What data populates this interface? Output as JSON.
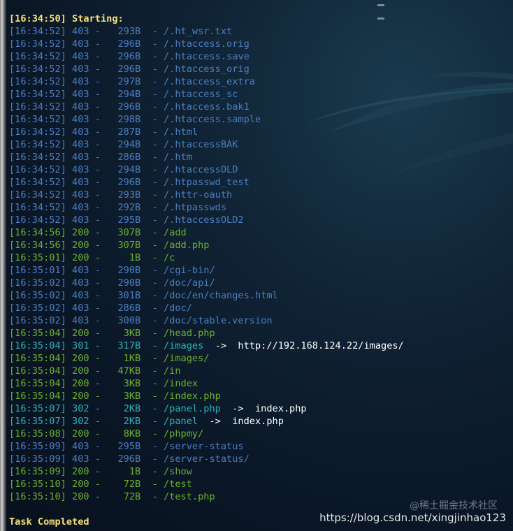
{
  "header": {
    "start_line": "[16:34:50] Starting:"
  },
  "log": [
    {
      "time": "[16:34:52]",
      "status": "403",
      "size": "293B",
      "path": "/.ht_wsr.txt",
      "redirect": ""
    },
    {
      "time": "[16:34:52]",
      "status": "403",
      "size": "296B",
      "path": "/.htaccess.orig",
      "redirect": ""
    },
    {
      "time": "[16:34:52]",
      "status": "403",
      "size": "296B",
      "path": "/.htaccess.save",
      "redirect": ""
    },
    {
      "time": "[16:34:52]",
      "status": "403",
      "size": "296B",
      "path": "/.htaccess_orig",
      "redirect": ""
    },
    {
      "time": "[16:34:52]",
      "status": "403",
      "size": "297B",
      "path": "/.htaccess_extra",
      "redirect": ""
    },
    {
      "time": "[16:34:52]",
      "status": "403",
      "size": "294B",
      "path": "/.htaccess_sc",
      "redirect": ""
    },
    {
      "time": "[16:34:52]",
      "status": "403",
      "size": "296B",
      "path": "/.htaccess.bak1",
      "redirect": ""
    },
    {
      "time": "[16:34:52]",
      "status": "403",
      "size": "298B",
      "path": "/.htaccess.sample",
      "redirect": ""
    },
    {
      "time": "[16:34:52]",
      "status": "403",
      "size": "287B",
      "path": "/.html",
      "redirect": ""
    },
    {
      "time": "[16:34:52]",
      "status": "403",
      "size": "294B",
      "path": "/.htaccessBAK",
      "redirect": ""
    },
    {
      "time": "[16:34:52]",
      "status": "403",
      "size": "286B",
      "path": "/.htm",
      "redirect": ""
    },
    {
      "time": "[16:34:52]",
      "status": "403",
      "size": "294B",
      "path": "/.htaccessOLD",
      "redirect": ""
    },
    {
      "time": "[16:34:52]",
      "status": "403",
      "size": "296B",
      "path": "/.htpasswd_test",
      "redirect": ""
    },
    {
      "time": "[16:34:52]",
      "status": "403",
      "size": "293B",
      "path": "/.httr-oauth",
      "redirect": ""
    },
    {
      "time": "[16:34:52]",
      "status": "403",
      "size": "292B",
      "path": "/.htpasswds",
      "redirect": ""
    },
    {
      "time": "[16:34:52]",
      "status": "403",
      "size": "295B",
      "path": "/.htaccessOLD2",
      "redirect": ""
    },
    {
      "time": "[16:34:56]",
      "status": "200",
      "size": "307B",
      "path": "/add",
      "redirect": ""
    },
    {
      "time": "[16:34:56]",
      "status": "200",
      "size": "307B",
      "path": "/add.php",
      "redirect": ""
    },
    {
      "time": "[16:35:01]",
      "status": "200",
      "size": "1B",
      "path": "/c",
      "redirect": ""
    },
    {
      "time": "[16:35:01]",
      "status": "403",
      "size": "290B",
      "path": "/cgi-bin/",
      "redirect": ""
    },
    {
      "time": "[16:35:02]",
      "status": "403",
      "size": "290B",
      "path": "/doc/api/",
      "redirect": ""
    },
    {
      "time": "[16:35:02]",
      "status": "403",
      "size": "301B",
      "path": "/doc/en/changes.html",
      "redirect": ""
    },
    {
      "time": "[16:35:02]",
      "status": "403",
      "size": "286B",
      "path": "/doc/",
      "redirect": ""
    },
    {
      "time": "[16:35:02]",
      "status": "403",
      "size": "300B",
      "path": "/doc/stable.version",
      "redirect": ""
    },
    {
      "time": "[16:35:04]",
      "status": "200",
      "size": "3KB",
      "path": "/head.php",
      "redirect": ""
    },
    {
      "time": "[16:35:04]",
      "status": "301",
      "size": "317B",
      "path": "/images",
      "redirect": "http://192.168.124.22/images/"
    },
    {
      "time": "[16:35:04]",
      "status": "200",
      "size": "1KB",
      "path": "/images/",
      "redirect": ""
    },
    {
      "time": "[16:35:04]",
      "status": "200",
      "size": "47KB",
      "path": "/in",
      "redirect": ""
    },
    {
      "time": "[16:35:04]",
      "status": "200",
      "size": "3KB",
      "path": "/index",
      "redirect": ""
    },
    {
      "time": "[16:35:04]",
      "status": "200",
      "size": "3KB",
      "path": "/index.php",
      "redirect": ""
    },
    {
      "time": "[16:35:07]",
      "status": "302",
      "size": "2KB",
      "path": "/panel.php",
      "redirect": "index.php"
    },
    {
      "time": "[16:35:07]",
      "status": "302",
      "size": "2KB",
      "path": "/panel",
      "redirect": "index.php"
    },
    {
      "time": "[16:35:08]",
      "status": "200",
      "size": "8KB",
      "path": "/phpmy/",
      "redirect": ""
    },
    {
      "time": "[16:35:09]",
      "status": "403",
      "size": "295B",
      "path": "/server-status",
      "redirect": ""
    },
    {
      "time": "[16:35:09]",
      "status": "403",
      "size": "296B",
      "path": "/server-status/",
      "redirect": ""
    },
    {
      "time": "[16:35:09]",
      "status": "200",
      "size": "1B",
      "path": "/show",
      "redirect": ""
    },
    {
      "time": "[16:35:10]",
      "status": "200",
      "size": "72B",
      "path": "/test",
      "redirect": ""
    },
    {
      "time": "[16:35:10]",
      "status": "200",
      "size": "72B",
      "path": "/test.php",
      "redirect": ""
    }
  ],
  "footer": {
    "task_completed": "Task Completed"
  },
  "watermark": {
    "site_name": "@稀土掘金技术社区",
    "url": "https://blog.csdn.net/xingjinhao123"
  },
  "colors": {
    "status_200": "#6bb02e",
    "status_30x": "#2fb1b8",
    "status_403": "#4b7fc2",
    "highlight": "#f6e27a",
    "redirect_target": "#ffffff"
  }
}
